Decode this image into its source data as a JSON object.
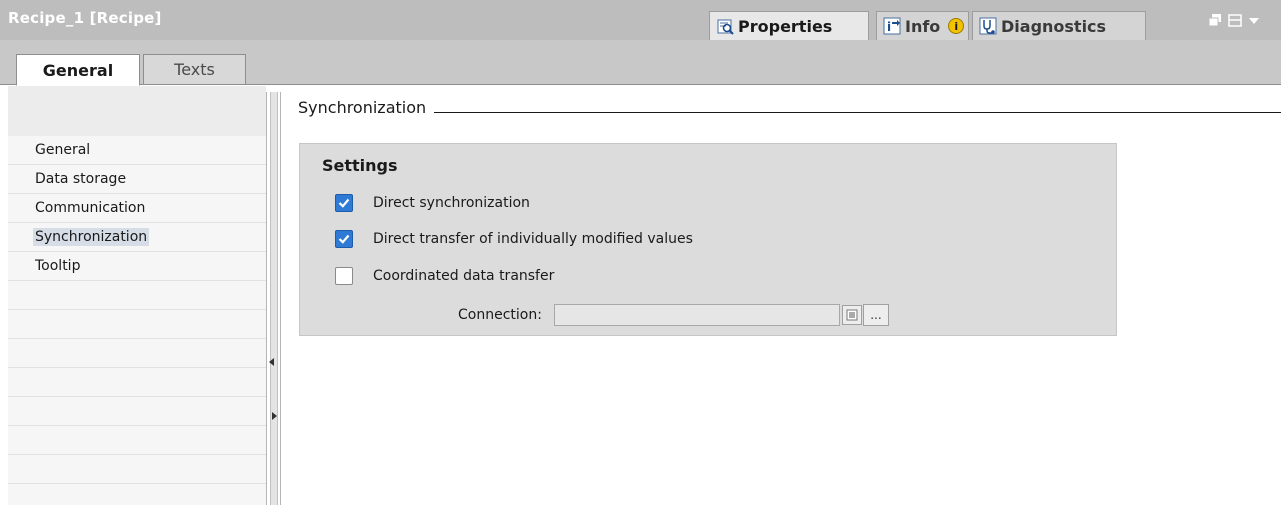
{
  "window": {
    "title": "Recipe_1 [Recipe]"
  },
  "inspector_tabs": [
    {
      "label": "Properties",
      "icon": "properties-icon",
      "active": true
    },
    {
      "label": "Info",
      "icon": "info-icon",
      "active": false
    },
    {
      "label": "Diagnostics",
      "icon": "diagnostics-icon",
      "active": false
    }
  ],
  "tabs": [
    {
      "label": "General",
      "active": true
    },
    {
      "label": "Texts",
      "active": false
    }
  ],
  "nav": {
    "items": [
      {
        "label": "General"
      },
      {
        "label": "Data storage"
      },
      {
        "label": "Communication"
      },
      {
        "label": "Synchronization",
        "selected": true
      },
      {
        "label": "Tooltip"
      }
    ]
  },
  "section": {
    "title": "Synchronization"
  },
  "settings": {
    "title": "Settings",
    "options": [
      {
        "label": "Direct synchronization",
        "checked": true
      },
      {
        "label": "Direct transfer of individually modified values",
        "checked": true
      },
      {
        "label": "Coordinated data transfer",
        "checked": false
      }
    ],
    "connection": {
      "label": "Connection:",
      "value": "",
      "browse_label": "..."
    }
  },
  "colors": {
    "checkbox_checked": "#2e7ad4",
    "titlebar": "#bdbdbd",
    "selection": "#d6dde6"
  }
}
